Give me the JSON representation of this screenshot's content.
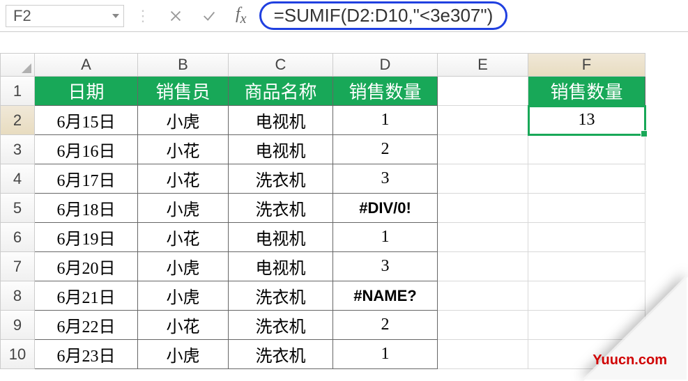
{
  "formulaBar": {
    "nameBox": "F2",
    "formula": "=SUMIF(D2:D10,\"<3e307\")"
  },
  "columns": [
    "A",
    "B",
    "C",
    "D",
    "E",
    "F"
  ],
  "rowNums": [
    "1",
    "2",
    "3",
    "4",
    "5",
    "6",
    "7",
    "8",
    "9",
    "10"
  ],
  "headers": {
    "A": "日期",
    "B": "销售员",
    "C": "商品名称",
    "D": "销售数量"
  },
  "fHeader": "销售数量",
  "fValue": "13",
  "table": [
    {
      "A": "6月15日",
      "B": "小虎",
      "C": "电视机",
      "D": "1"
    },
    {
      "A": "6月16日",
      "B": "小花",
      "C": "电视机",
      "D": "2"
    },
    {
      "A": "6月17日",
      "B": "小花",
      "C": "洗衣机",
      "D": "3"
    },
    {
      "A": "6月18日",
      "B": "小虎",
      "C": "洗衣机",
      "D": "#DIV/0!"
    },
    {
      "A": "6月19日",
      "B": "小花",
      "C": "电视机",
      "D": "1"
    },
    {
      "A": "6月20日",
      "B": "小虎",
      "C": "电视机",
      "D": "3"
    },
    {
      "A": "6月21日",
      "B": "小虎",
      "C": "洗衣机",
      "D": "#NAME?"
    },
    {
      "A": "6月22日",
      "B": "小花",
      "C": "洗衣机",
      "D": "2"
    },
    {
      "A": "6月23日",
      "B": "小虎",
      "C": "洗衣机",
      "D": "1"
    }
  ],
  "watermark": "Yuucn.com",
  "activeCell": "F2"
}
